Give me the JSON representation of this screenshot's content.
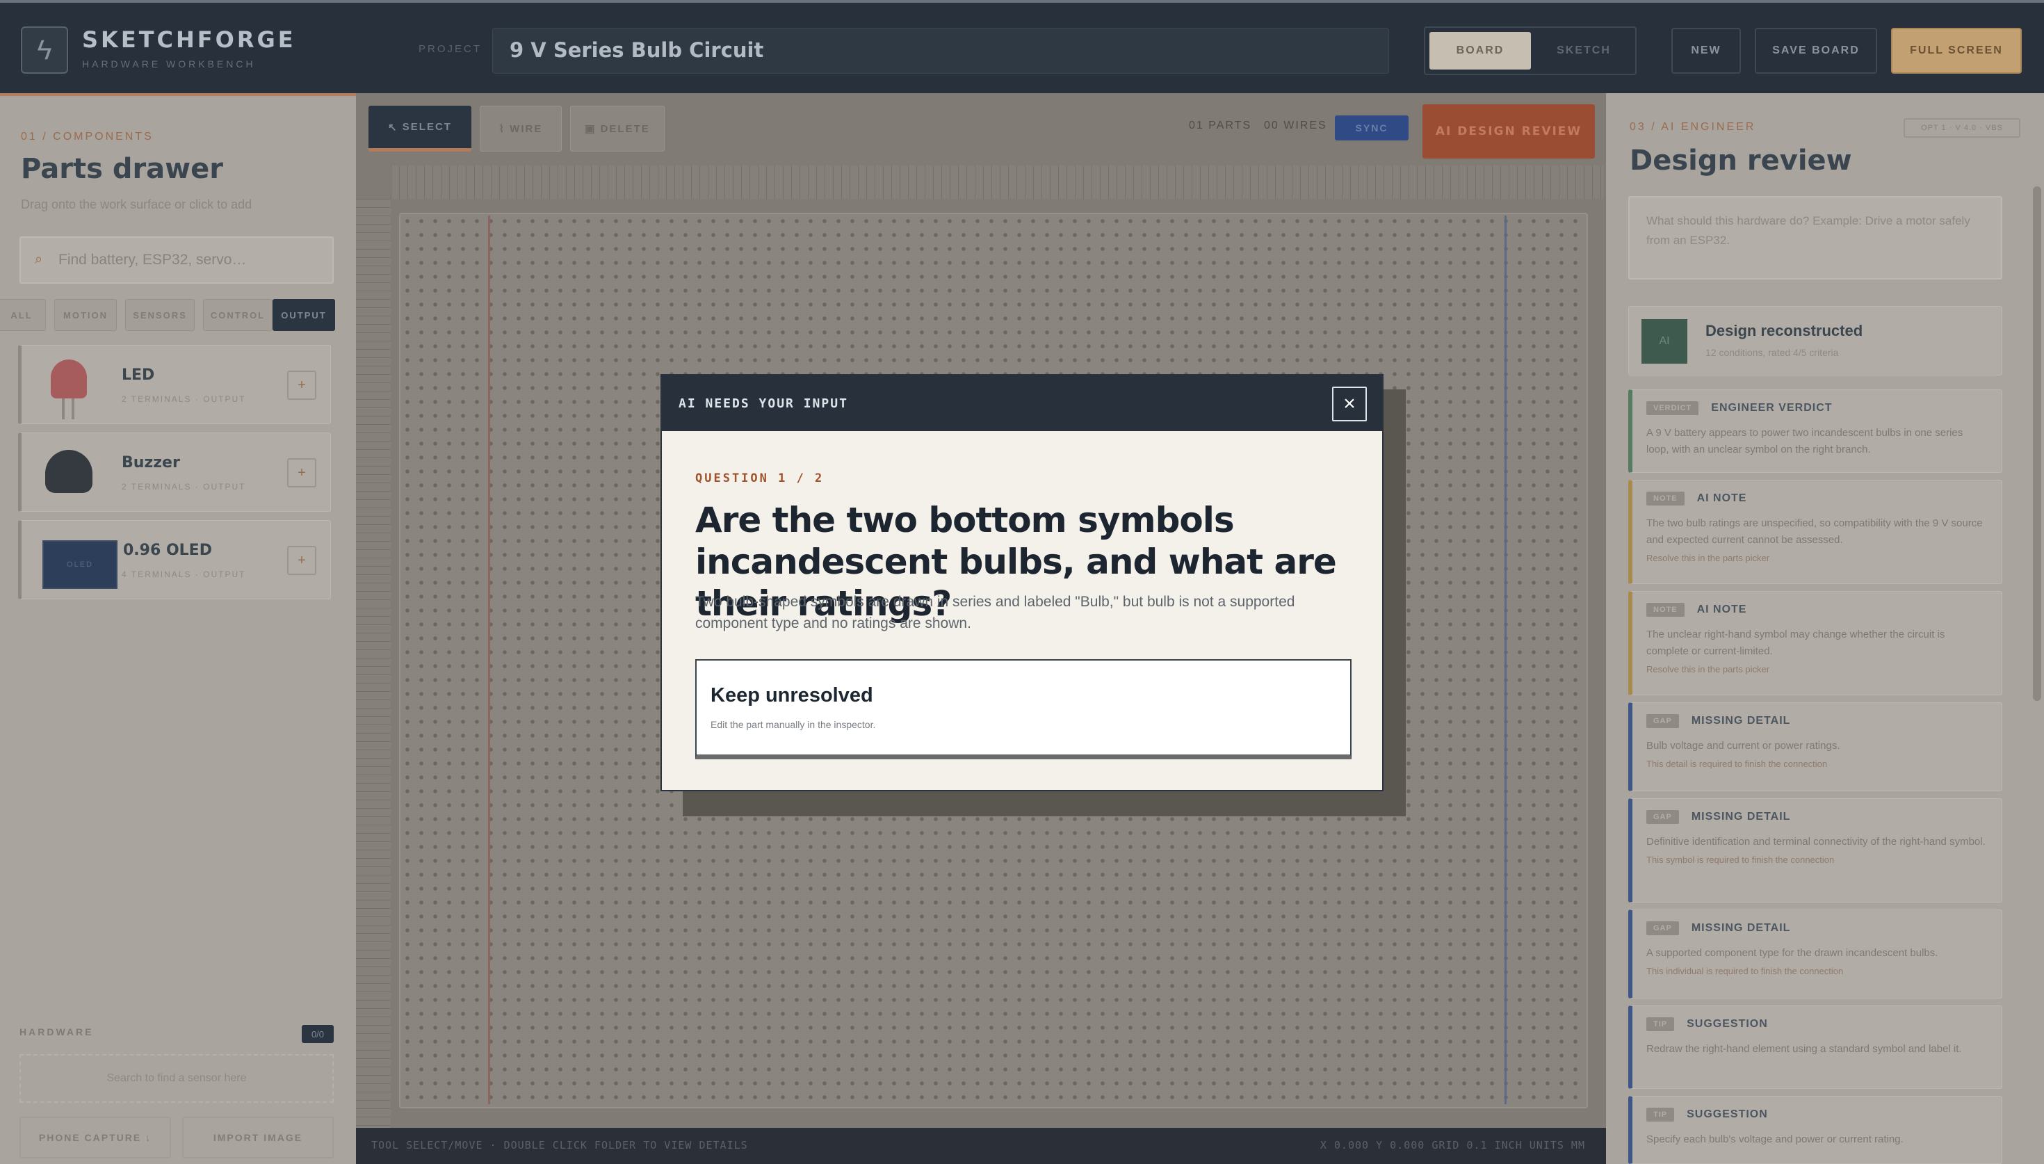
{
  "topbar": {
    "brand": "SKETCHFORGE",
    "brand_sub": "HARDWARE WORKBENCH",
    "project_label": "PROJECT",
    "project_title": "9 V Series Bulb Circuit",
    "mode_board": "BOARD",
    "mode_sketch": "SKETCH",
    "new": "NEW",
    "save_board": "SAVE BOARD",
    "full_screen": "FULL SCREEN",
    "logo_icon": "bolt-icon"
  },
  "left": {
    "crumb": "01 / COMPONENTS",
    "title": "Parts drawer",
    "subtitle": "Drag onto the work surface or click to add",
    "search_placeholder": "Find battery, ESP32, servo…",
    "chips": [
      "ALL",
      "MOTION",
      "SENSORS",
      "CONTROL",
      "OUTPUT"
    ],
    "active_chip": "OUTPUT",
    "parts": [
      {
        "name": "LED",
        "meta": "2 TERMINALS · OUTPUT"
      },
      {
        "name": "Buzzer",
        "meta": "2 TERMINALS · OUTPUT"
      },
      {
        "name": "0.96 OLED",
        "meta": "4 TERMINALS · OUTPUT",
        "thumb": "OLED"
      }
    ],
    "add_glyph": "+",
    "hardware_label": "HARDWARE",
    "hardware_count": "0/0",
    "hardware_empty": "Search to find a sensor here",
    "phone_capture": "PHONE CAPTURE ↓",
    "import_image": "IMPORT IMAGE"
  },
  "workspace": {
    "tools": {
      "select": "SELECT",
      "wire": "WIRE",
      "delete": "DELETE"
    },
    "stat1": "01 PARTS",
    "stat2": "00 WIRES",
    "badge": "SYNC",
    "ai_review": "AI DESIGN REVIEW",
    "status_left": "TOOL SELECT/MOVE · DOUBLE CLICK FOLDER TO VIEW DETAILS",
    "status_right": "X 0.000  Y 0.000  GRID 0.1 INCH  UNITS MM"
  },
  "right": {
    "crumb": "03 / AI ENGINEER",
    "tag": "OPT 1 · V 4.0 · VBS",
    "title": "Design review",
    "ask_placeholder": "What should this hardware do? Example: Drive a motor safely from an ESP32.",
    "summary_title": "Design reconstructed",
    "summary_sub": "12 conditions, rated 4/5 criteria",
    "summary_badge": "AI",
    "cards": [
      {
        "tag": "VERDICT",
        "title": "ENGINEER VERDICT",
        "text": "A 9 V battery appears to power two incandescent bulbs in one series loop, with an unclear symbol on the right branch.",
        "fix": ""
      },
      {
        "tag": "NOTE",
        "title": "AI NOTE",
        "text": "The two bulb ratings are unspecified, so compatibility with the 9 V source and expected current cannot be assessed.",
        "fix": "Resolve this in the parts picker"
      },
      {
        "tag": "NOTE",
        "title": "AI NOTE",
        "text": "The unclear right-hand symbol may change whether the circuit is complete or current-limited.",
        "fix": "Resolve this in the parts picker"
      },
      {
        "tag": "GAP",
        "title": "MISSING DETAIL",
        "text": "Bulb voltage and current or power ratings.",
        "fix": "This detail is required to finish the connection"
      },
      {
        "tag": "GAP",
        "title": "MISSING DETAIL",
        "text": "Definitive identification and terminal connectivity of the right-hand symbol.",
        "fix": "This symbol is required to finish the connection"
      },
      {
        "tag": "GAP",
        "title": "MISSING DETAIL",
        "text": "A supported component type for the drawn incandescent bulbs.",
        "fix": "This individual is required to finish the connection"
      },
      {
        "tag": "TIP",
        "title": "SUGGESTION",
        "text": "Redraw the right-hand element using a standard symbol and label it.",
        "fix": ""
      },
      {
        "tag": "TIP",
        "title": "SUGGESTION",
        "text": "Specify each bulb's voltage and power or current rating.",
        "fix": ""
      }
    ]
  },
  "modal": {
    "header": "AI NEEDS YOUR INPUT",
    "close_glyph": "×",
    "question_counter": "QUESTION 1 / 2",
    "question": "Are the two bottom symbols incandescent bulbs, and what are their ratings?",
    "description": "Two bulb-shaped symbols are drawn in series and labeled \"Bulb,\" but bulb is not a supported component type and no ratings are shown.",
    "option_title": "Keep unresolved",
    "option_sub": "Edit the part manually in the inspector."
  },
  "colors": {
    "accent": "#a0522d",
    "dark": "#28313b",
    "ai_button": "#c0603e",
    "full_screen": "#e7b97b"
  }
}
